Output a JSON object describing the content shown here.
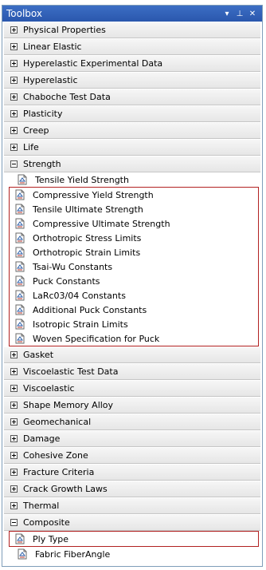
{
  "window": {
    "title": "Toolbox",
    "dropdown_glyph": "▾",
    "pin_glyph": "⊥",
    "close_glyph": "✕"
  },
  "categories_before": [
    {
      "label": "Physical Properties",
      "expanded": false
    },
    {
      "label": "Linear Elastic",
      "expanded": false
    },
    {
      "label": "Hyperelastic Experimental Data",
      "expanded": false
    },
    {
      "label": "Hyperelastic",
      "expanded": false
    },
    {
      "label": "Chaboche Test Data",
      "expanded": false
    },
    {
      "label": "Plasticity",
      "expanded": false
    },
    {
      "label": "Creep",
      "expanded": false
    },
    {
      "label": "Life",
      "expanded": false
    }
  ],
  "strength": {
    "label": "Strength",
    "expanded": true,
    "first_item": "Tensile Yield Strength",
    "highlighted_items": [
      "Compressive Yield Strength",
      "Tensile Ultimate Strength",
      "Compressive Ultimate Strength",
      "Orthotropic Stress Limits",
      "Orthotropic Strain Limits",
      "Tsai-Wu Constants",
      "Puck Constants",
      "LaRc03/04 Constants",
      "Additional Puck Constants",
      "Isotropic Strain Limits",
      "Woven Specification for Puck"
    ]
  },
  "categories_after": [
    {
      "label": "Gasket",
      "expanded": false
    },
    {
      "label": "Viscoelastic Test Data",
      "expanded": false
    },
    {
      "label": "Viscoelastic",
      "expanded": false
    },
    {
      "label": "Shape Memory Alloy",
      "expanded": false
    },
    {
      "label": "Geomechanical",
      "expanded": false
    },
    {
      "label": "Damage",
      "expanded": false
    },
    {
      "label": "Cohesive Zone",
      "expanded": false
    },
    {
      "label": "Fracture Criteria",
      "expanded": false
    },
    {
      "label": "Crack Growth Laws",
      "expanded": false
    },
    {
      "label": "Thermal",
      "expanded": false
    }
  ],
  "composite": {
    "label": "Composite",
    "expanded": true,
    "highlighted_items": [
      "Ply Type"
    ],
    "items": [
      "Fabric FiberAngle"
    ]
  },
  "colors": {
    "titlebar": "#2f5fb8",
    "highlight_border": "#b22222"
  },
  "icons": {
    "item": "property-document-icon",
    "expand": "plus-box-icon",
    "collapse": "minus-box-icon"
  }
}
